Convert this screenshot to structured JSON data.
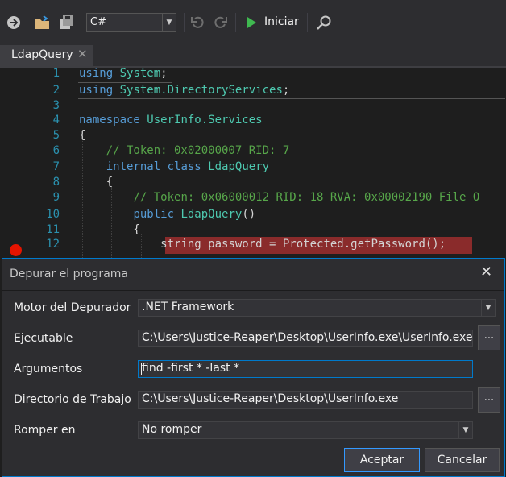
{
  "toolbar": {
    "language": "C#",
    "run_label": "Iniciar",
    "icons": [
      "navigate-forward-icon",
      "open-folder-icon",
      "save-all-icon",
      "undo-icon",
      "redo-icon",
      "play-icon",
      "search-icon"
    ]
  },
  "tab": {
    "label": "LdapQuery",
    "close": "✕"
  },
  "editor": {
    "lines": [
      {
        "n": "1",
        "parts": [
          [
            "kw",
            "using"
          ],
          [
            "pl",
            " "
          ],
          [
            "ty",
            "System"
          ],
          [
            "pl",
            ";"
          ]
        ]
      },
      {
        "n": "2",
        "parts": [
          [
            "kw",
            "using"
          ],
          [
            "pl",
            " "
          ],
          [
            "ty",
            "System.DirectoryServices"
          ],
          [
            "pl",
            ";"
          ]
        ]
      },
      {
        "n": "3",
        "parts": []
      },
      {
        "n": "4",
        "parts": [
          [
            "kw",
            "namespace"
          ],
          [
            "pl",
            " "
          ],
          [
            "ty",
            "UserInfo.Services"
          ]
        ]
      },
      {
        "n": "5",
        "parts": [
          [
            "pl",
            "{"
          ]
        ]
      },
      {
        "n": "6",
        "parts": [
          [
            "pl",
            "    "
          ],
          [
            "cm",
            "// Token: 0x02000007 RID: 7"
          ]
        ]
      },
      {
        "n": "7",
        "parts": [
          [
            "pl",
            "    "
          ],
          [
            "kw",
            "internal"
          ],
          [
            "pl",
            " "
          ],
          [
            "kw",
            "class"
          ],
          [
            "pl",
            " "
          ],
          [
            "ty",
            "LdapQuery"
          ]
        ]
      },
      {
        "n": "8",
        "parts": [
          [
            "pl",
            "    {"
          ]
        ]
      },
      {
        "n": "9",
        "parts": [
          [
            "pl",
            "        "
          ],
          [
            "cm",
            "// Token: 0x06000012 RID: 18 RVA: 0x00002190 File O"
          ]
        ]
      },
      {
        "n": "10",
        "parts": [
          [
            "pl",
            "        "
          ],
          [
            "kw",
            "public"
          ],
          [
            "pl",
            " "
          ],
          [
            "ty",
            "LdapQuery"
          ],
          [
            "pl",
            "()"
          ]
        ]
      },
      {
        "n": "11",
        "parts": [
          [
            "pl",
            "        {"
          ]
        ]
      },
      {
        "n": "12",
        "parts": [
          [
            "pl",
            "            "
          ],
          [
            "pl",
            "string password = Protected.getPassword();"
          ]
        ]
      }
    ]
  },
  "dialog": {
    "title": "Depurar el programa",
    "close": "✕",
    "rows": {
      "engine": {
        "label": "Motor del Depurador",
        "value": ".NET Framework"
      },
      "exe": {
        "label": "Ejecutable",
        "value": "C:\\Users\\Justice-Reaper\\Desktop\\UserInfo.exe\\UserInfo.exe",
        "browse": "..."
      },
      "args": {
        "label": "Argumentos",
        "value": "find -first * -last *"
      },
      "workdir": {
        "label": "Directorio de Trabajo",
        "value": "C:\\Users\\Justice-Reaper\\Desktop\\UserInfo.exe",
        "browse": "..."
      },
      "break": {
        "label": "Romper en",
        "value": "No romper"
      }
    },
    "accept": "Aceptar",
    "cancel": "Cancelar"
  }
}
